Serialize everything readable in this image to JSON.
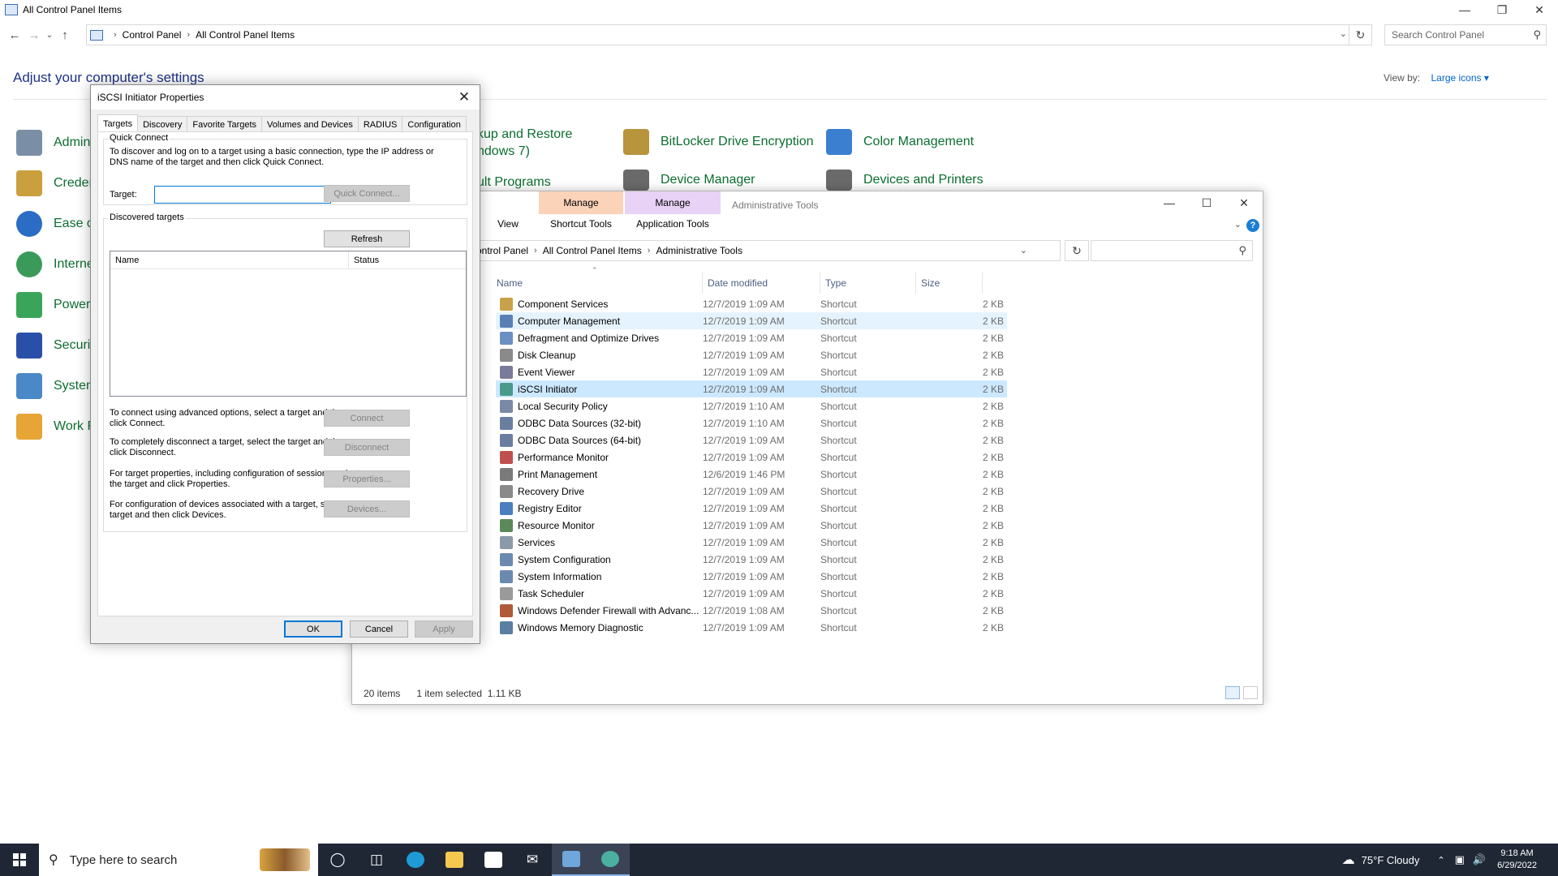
{
  "control_panel": {
    "window_title": "All Control Panel Items",
    "breadcrumb": [
      "Control Panel",
      "All Control Panel Items"
    ],
    "search_placeholder": "Search Control Panel",
    "heading": "Adjust your computer's settings",
    "view_by_label": "View by:",
    "view_by_value": "Large icons",
    "items": [
      {
        "label": "Admini",
        "icon": "admin-tools-icon",
        "color": "#7a8fa6"
      },
      {
        "label": "Creden",
        "icon": "credential-manager-icon",
        "color": "#c9a03d"
      },
      {
        "label": "Ease of",
        "icon": "ease-of-access-icon",
        "color": "#2b6cc4"
      },
      {
        "label": "Interne",
        "icon": "internet-options-icon",
        "color": "#3a9a5a"
      },
      {
        "label": "Power C",
        "icon": "power-options-icon",
        "color": "#3aa55a"
      },
      {
        "label": "Securit",
        "icon": "security-maintenance-icon",
        "color": "#2a4fa8"
      },
      {
        "label": "System",
        "icon": "system-icon",
        "color": "#4a88c7"
      },
      {
        "label": "Work F",
        "icon": "work-folders-icon",
        "color": "#e6a534"
      },
      {
        "label": "kup and Restore",
        "icon": "backup-restore-icon",
        "color": "#4a9a55"
      },
      {
        "label": "ndows 7)",
        "icon": "",
        "color": ""
      },
      {
        "label": "BitLocker Drive Encryption",
        "icon": "bitlocker-icon",
        "color": "#b8943c"
      },
      {
        "label": "Color Management",
        "icon": "color-management-icon",
        "color": "#3b7fd0"
      },
      {
        "label": "ult Programs",
        "icon": "default-programs-icon",
        "color": ""
      },
      {
        "label": "Device Manager",
        "icon": "device-manager-icon",
        "color": "#6a6a6a"
      },
      {
        "label": "Devices and Printers",
        "icon": "devices-printers-icon",
        "color": "#6a6a6a"
      }
    ]
  },
  "admin_tools": {
    "window_title": "Administrative Tools",
    "ribbon": {
      "manage_1": "Manage",
      "manage_2": "Manage",
      "view": "View",
      "shortcut_tools": "Shortcut Tools",
      "application_tools": "Application Tools",
      "shortcut_color": "#fbd3b9",
      "application_color": "#e8d2f5"
    },
    "breadcrumb": [
      "ontrol Panel",
      "All Control Panel Items",
      "Administrative Tools"
    ],
    "columns": {
      "name": "Name",
      "date": "Date modified",
      "type": "Type",
      "size": "Size"
    },
    "files": [
      {
        "name": "Component Services",
        "date": "12/7/2019 1:09 AM",
        "type": "Shortcut",
        "size": "2 KB",
        "color": "#c8a24a"
      },
      {
        "name": "Computer Management",
        "date": "12/7/2019 1:09 AM",
        "type": "Shortcut",
        "size": "2 KB",
        "color": "#5a7fb5"
      },
      {
        "name": "Defragment and Optimize Drives",
        "date": "12/7/2019 1:09 AM",
        "type": "Shortcut",
        "size": "2 KB",
        "color": "#6b8fc0"
      },
      {
        "name": "Disk Cleanup",
        "date": "12/7/2019 1:09 AM",
        "type": "Shortcut",
        "size": "2 KB",
        "color": "#8a8a8a"
      },
      {
        "name": "Event Viewer",
        "date": "12/7/2019 1:09 AM",
        "type": "Shortcut",
        "size": "2 KB",
        "color": "#7a7a9a"
      },
      {
        "name": "iSCSI Initiator",
        "date": "12/7/2019 1:09 AM",
        "type": "Shortcut",
        "size": "2 KB",
        "color": "#4a9a8a"
      },
      {
        "name": "Local Security Policy",
        "date": "12/7/2019 1:10 AM",
        "type": "Shortcut",
        "size": "2 KB",
        "color": "#7a8aa6"
      },
      {
        "name": "ODBC Data Sources (32-bit)",
        "date": "12/7/2019 1:10 AM",
        "type": "Shortcut",
        "size": "2 KB",
        "color": "#6a7fa0"
      },
      {
        "name": "ODBC Data Sources (64-bit)",
        "date": "12/7/2019 1:09 AM",
        "type": "Shortcut",
        "size": "2 KB",
        "color": "#6a7fa0"
      },
      {
        "name": "Performance Monitor",
        "date": "12/7/2019 1:09 AM",
        "type": "Shortcut",
        "size": "2 KB",
        "color": "#c0504d"
      },
      {
        "name": "Print Management",
        "date": "12/6/2019 1:46 PM",
        "type": "Shortcut",
        "size": "2 KB",
        "color": "#7a7a7a"
      },
      {
        "name": "Recovery Drive",
        "date": "12/7/2019 1:09 AM",
        "type": "Shortcut",
        "size": "2 KB",
        "color": "#8a8a8a"
      },
      {
        "name": "Registry Editor",
        "date": "12/7/2019 1:09 AM",
        "type": "Shortcut",
        "size": "2 KB",
        "color": "#4a7fc0"
      },
      {
        "name": "Resource Monitor",
        "date": "12/7/2019 1:09 AM",
        "type": "Shortcut",
        "size": "2 KB",
        "color": "#5a8a5a"
      },
      {
        "name": "Services",
        "date": "12/7/2019 1:09 AM",
        "type": "Shortcut",
        "size": "2 KB",
        "color": "#8a9aaa"
      },
      {
        "name": "System Configuration",
        "date": "12/7/2019 1:09 AM",
        "type": "Shortcut",
        "size": "2 KB",
        "color": "#6a8ab0"
      },
      {
        "name": "System Information",
        "date": "12/7/2019 1:09 AM",
        "type": "Shortcut",
        "size": "2 KB",
        "color": "#6a8ab0"
      },
      {
        "name": "Task Scheduler",
        "date": "12/7/2019 1:09 AM",
        "type": "Shortcut",
        "size": "2 KB",
        "color": "#9a9a9a"
      },
      {
        "name": "Windows Defender Firewall with Advanc...",
        "date": "12/7/2019 1:08 AM",
        "type": "Shortcut",
        "size": "2 KB",
        "color": "#b05a3a"
      },
      {
        "name": "Windows Memory Diagnostic",
        "date": "12/7/2019 1:09 AM",
        "type": "Shortcut",
        "size": "2 KB",
        "color": "#5a7fa0"
      }
    ],
    "status": {
      "count": "20 items",
      "selected": "1 item selected",
      "size": "1.11 KB"
    }
  },
  "iscsi_dialog": {
    "title": "iSCSI Initiator Properties",
    "tabs": [
      "Targets",
      "Discovery",
      "Favorite Targets",
      "Volumes and Devices",
      "RADIUS",
      "Configuration"
    ],
    "quick_connect_label": "Quick Connect",
    "quick_connect_desc": "To discover and log on to a target using a basic connection, type the IP address or DNS name of the target and then click Quick Connect.",
    "target_label": "Target:",
    "target_value": "",
    "quick_connect_button": "Quick Connect...",
    "discovered_label": "Discovered targets",
    "refresh_button": "Refresh",
    "list_columns": {
      "name": "Name",
      "status": "Status"
    },
    "connect_desc": "To connect using advanced options, select a target and then click Connect.",
    "connect_button": "Connect",
    "disconnect_desc": "To completely disconnect a target, select the target and then click Disconnect.",
    "disconnect_button": "Disconnect",
    "properties_desc": "For target properties, including configuration of sessions, select the target and click Properties.",
    "properties_button": "Properties...",
    "devices_desc": "For configuration of devices associated with a target, select the target and then click Devices.",
    "devices_button": "Devices...",
    "ok_button": "OK",
    "cancel_button": "Cancel",
    "apply_button": "Apply"
  },
  "taskbar": {
    "search_placeholder": "Type here to search",
    "weather": "75°F  Cloudy",
    "time": "9:18 AM",
    "date": "6/29/2022"
  }
}
